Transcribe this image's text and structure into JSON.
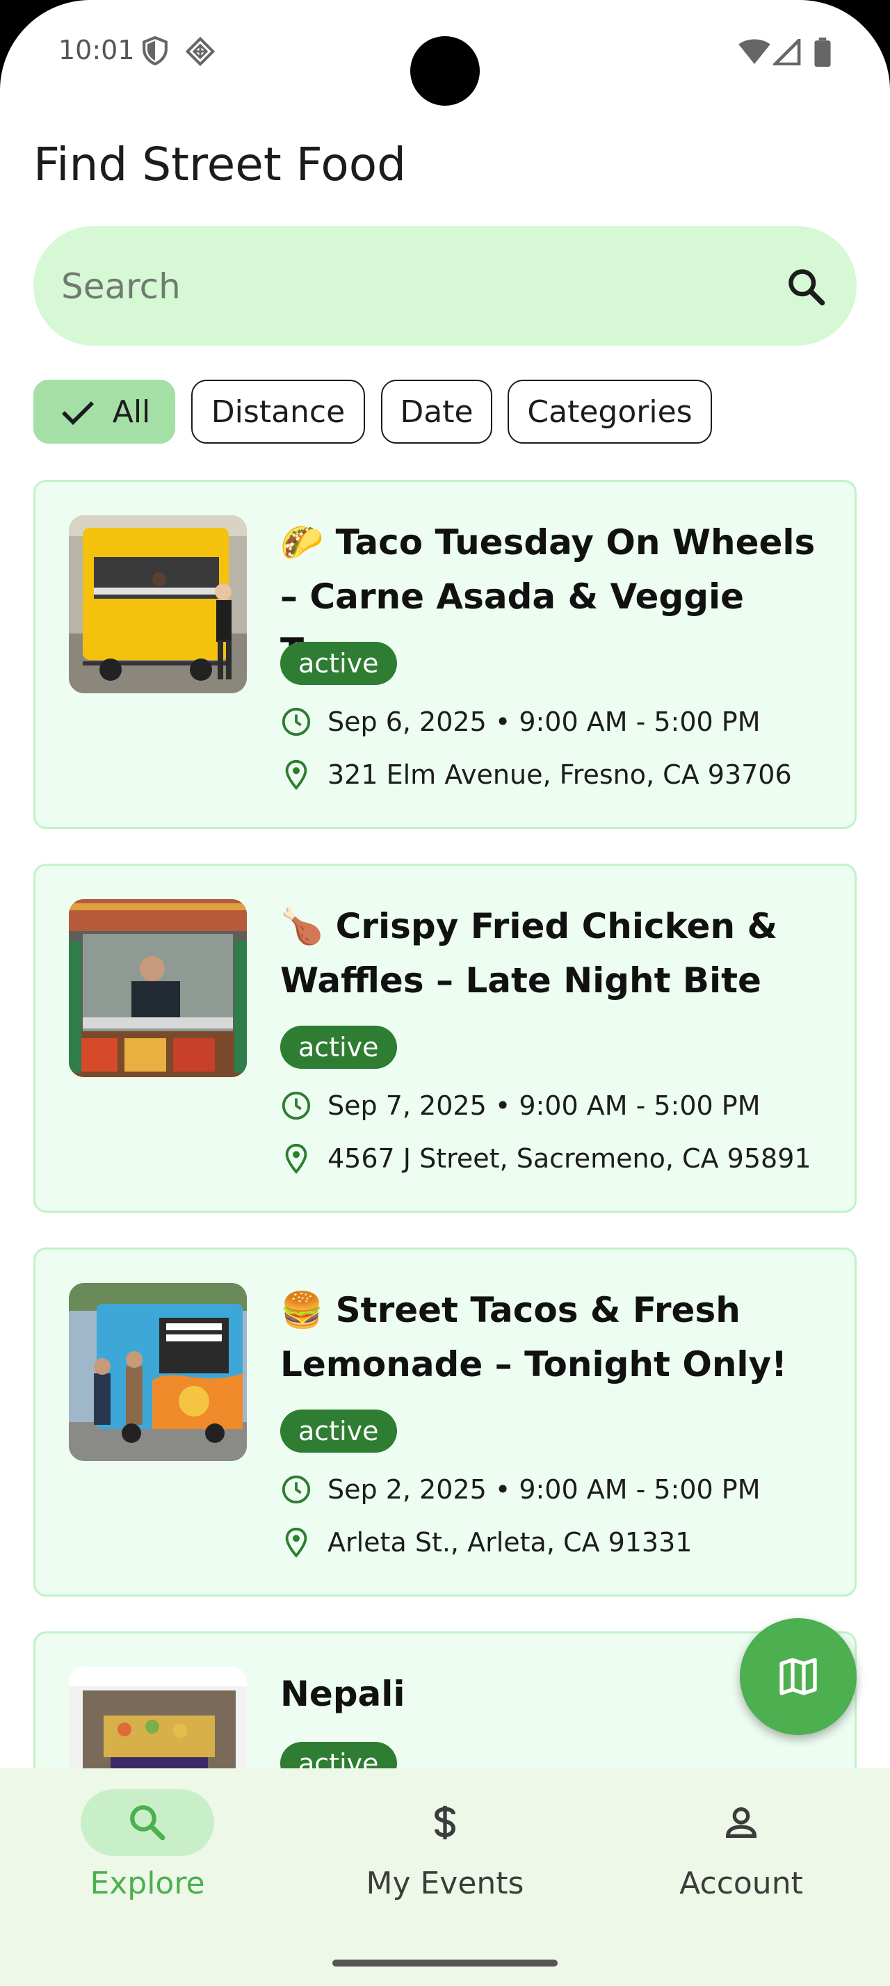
{
  "status_bar": {
    "time": "10:01"
  },
  "page_title": "Find Street Food",
  "search": {
    "placeholder": "Search",
    "value": ""
  },
  "filters": [
    {
      "label": "All",
      "selected": true
    },
    {
      "label": "Distance",
      "selected": false
    },
    {
      "label": "Date",
      "selected": false
    },
    {
      "label": "Categories",
      "selected": false
    }
  ],
  "events": [
    {
      "title": "🌮 Taco Tuesday On Wheels – Carne Asada & Veggie Tacos",
      "status": "active",
      "datetime": "Sep 6, 2025 • 9:00 AM - 5:00 PM",
      "location": "321 Elm Avenue, Fresno, CA 93706"
    },
    {
      "title": "🍗 Crispy Fried Chicken & Waffles – Late Night Bite",
      "status": "active",
      "datetime": "Sep 7, 2025 • 9:00 AM - 5:00 PM",
      "location": "4567 J Street, Sacremeno, CA 95891"
    },
    {
      "title": "🍔 Street Tacos & Fresh Lemonade – Tonight Only!",
      "status": "active",
      "datetime": "Sep 2, 2025 • 9:00 AM - 5:00 PM",
      "location": "Arleta St., Arleta, CA 91331"
    },
    {
      "title": "Nepali",
      "status": "active"
    }
  ],
  "bottom_nav": [
    {
      "label": "Explore",
      "icon": "search-icon",
      "active": true
    },
    {
      "label": "My Events",
      "icon": "dollar-icon",
      "active": false
    },
    {
      "label": "Account",
      "icon": "person-icon",
      "active": false
    }
  ],
  "colors": {
    "accent": "#4caf50",
    "badge": "#2e7d32",
    "search_bg": "#d6f8d4",
    "card_bg": "#edfdf1",
    "nav_bg": "#edf8e8"
  }
}
